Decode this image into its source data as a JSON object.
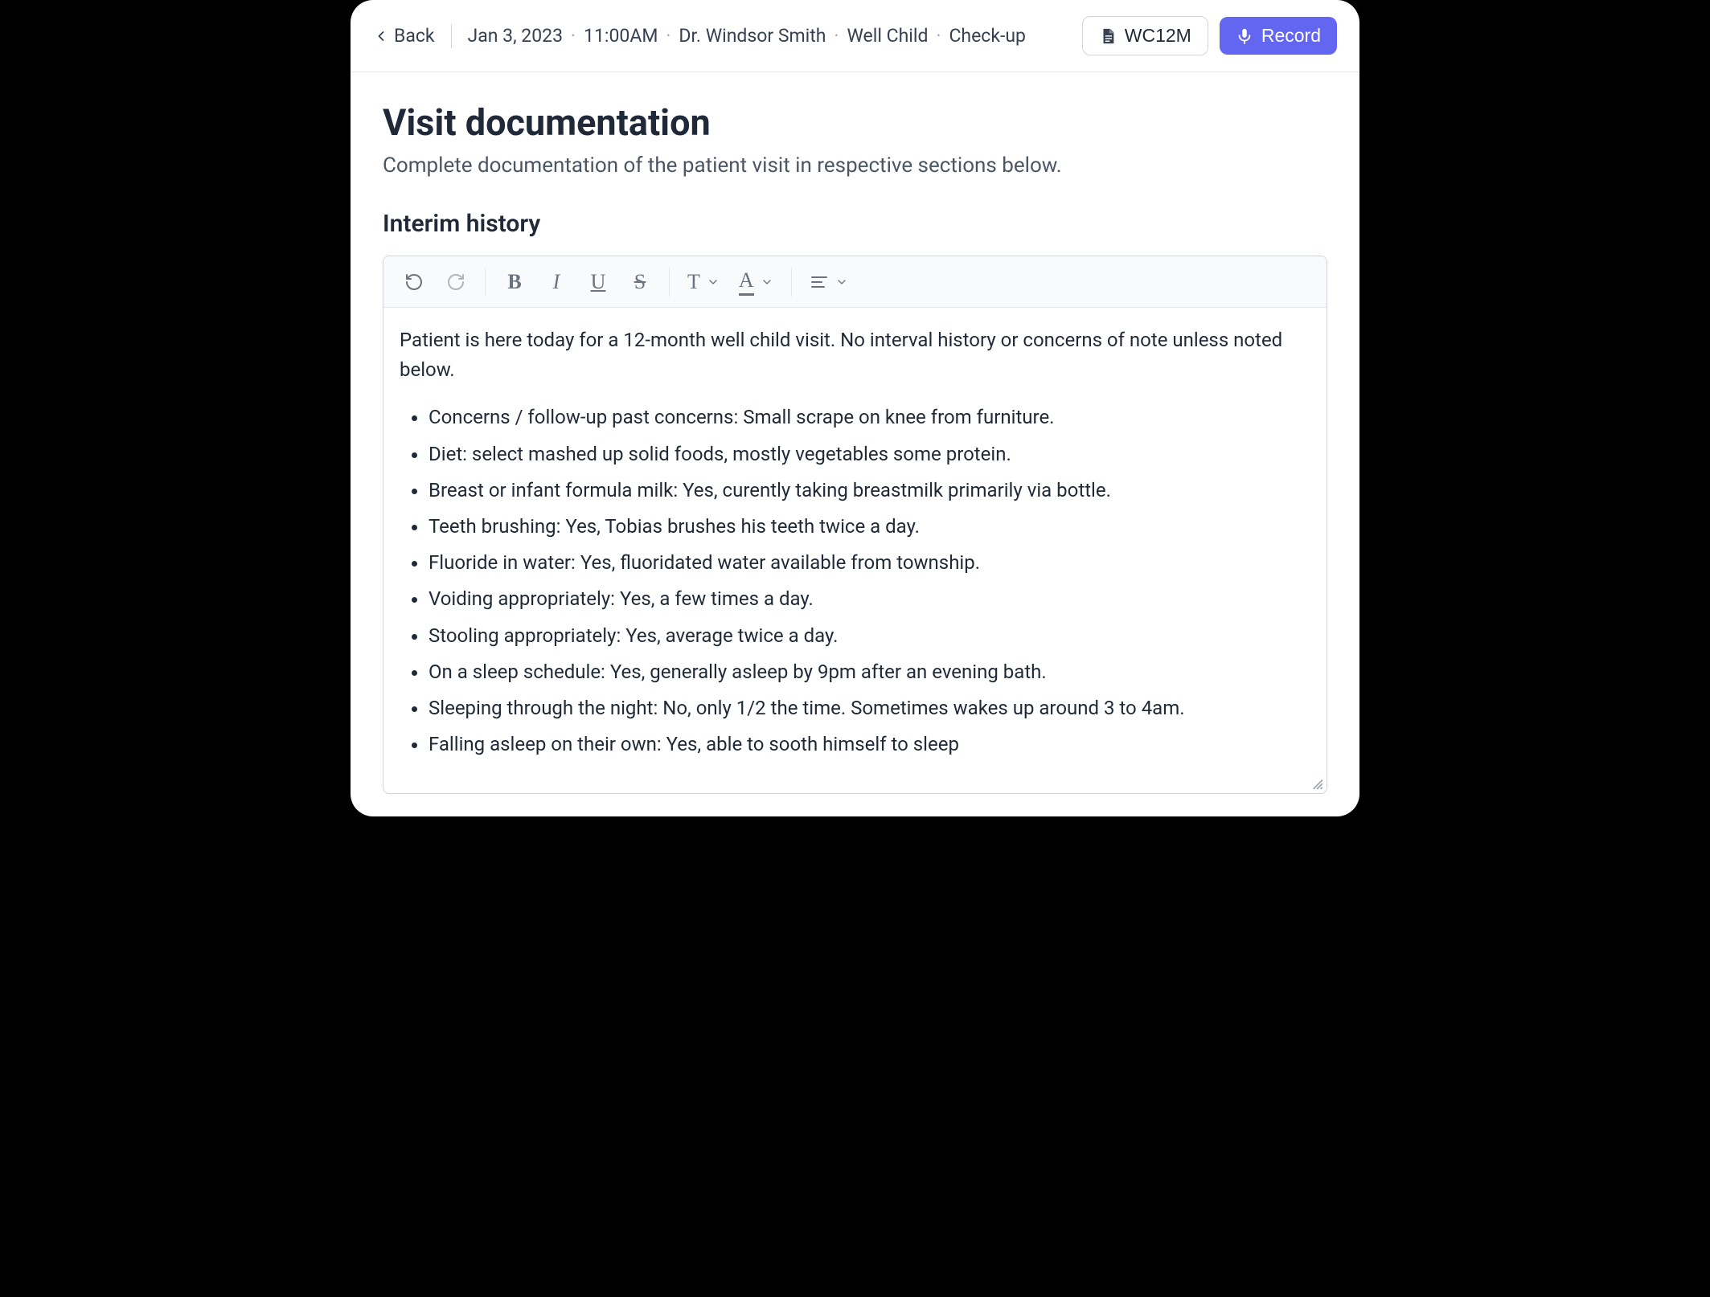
{
  "header": {
    "back_label": "Back",
    "crumbs": {
      "date": "Jan 3, 2023",
      "time": "11:00AM",
      "provider": "Dr. Windsor Smith",
      "visit_type": "Well Child",
      "visit_subtype": "Check-up"
    },
    "template_button_label": "WC12M",
    "record_button_label": "Record"
  },
  "page": {
    "title": "Visit documentation",
    "subtitle": "Complete documentation of the patient visit in respective sections below."
  },
  "section": {
    "title": "Interim history"
  },
  "toolbar": {
    "undo": "undo",
    "redo": "redo",
    "bold": "B",
    "italic": "I",
    "underline": "U",
    "strike": "S",
    "text_style": "T",
    "text_color": "A",
    "align": "align"
  },
  "note": {
    "intro": "Patient is here today for a 12-month well child visit. No interval history or concerns of note unless noted below.",
    "items": [
      "Concerns / follow-up past concerns: Small scrape on knee from furniture.",
      "Diet: select mashed up solid foods, mostly vegetables some protein.",
      "Breast or infant formula milk: Yes, curently taking breastmilk primarily via bottle.",
      "Teeth brushing: Yes, Tobias brushes his teeth twice a day.",
      "Fluoride in water: Yes, fluoridated water available from township.",
      "Voiding appropriately: Yes, a few times a day.",
      "Stooling appropriately: Yes, average twice a day.",
      "On a sleep schedule: Yes, generally asleep by 9pm after an evening bath.",
      "Sleeping through the night: No, only 1/2 the time. Sometimes wakes up around 3 to 4am.",
      "Falling asleep on their own: Yes, able to sooth himself to sleep"
    ]
  }
}
